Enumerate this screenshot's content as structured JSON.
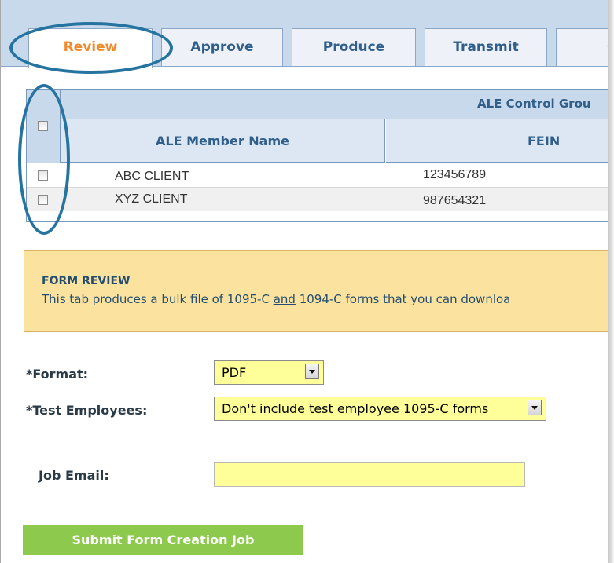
{
  "tabs": [
    {
      "label": "Review",
      "active": true
    },
    {
      "label": "Approve",
      "active": false
    },
    {
      "label": "Produce",
      "active": false
    },
    {
      "label": "Transmit",
      "active": false
    },
    {
      "label": "Co",
      "active": false
    }
  ],
  "grid": {
    "group_header": "ALE Control Grou",
    "columns": [
      "ALE Member Name",
      "FEIN"
    ],
    "rows": [
      {
        "name": "ABC CLIENT",
        "fein": "123456789",
        "checked": false
      },
      {
        "name": "XYZ CLIENT",
        "fein": "987654321",
        "checked": false
      }
    ]
  },
  "info": {
    "title": "FORM REVIEW",
    "text_before": "This tab produces a bulk file of 1095-C ",
    "text_underlined": "and",
    "text_after": " 1094-C forms that you can downloa"
  },
  "form": {
    "format_label": "*Format:",
    "format_value": "PDF",
    "test_employees_label": "*Test Employees:",
    "test_employees_value": "Don't include test employee 1095-C forms",
    "job_email_label": "Job Email:",
    "job_email_value": ""
  },
  "submit_label": "Submit Form Creation Job",
  "colors": {
    "active_tab_text": "#f08a2a",
    "tab_text": "#2f5f8a",
    "header_bg": "#c9d9ec",
    "annotation_ellipse": "#2574a0",
    "info_bg": "#fbe29e",
    "input_bg": "#ffff99",
    "submit_bg": "#8cc94c"
  }
}
